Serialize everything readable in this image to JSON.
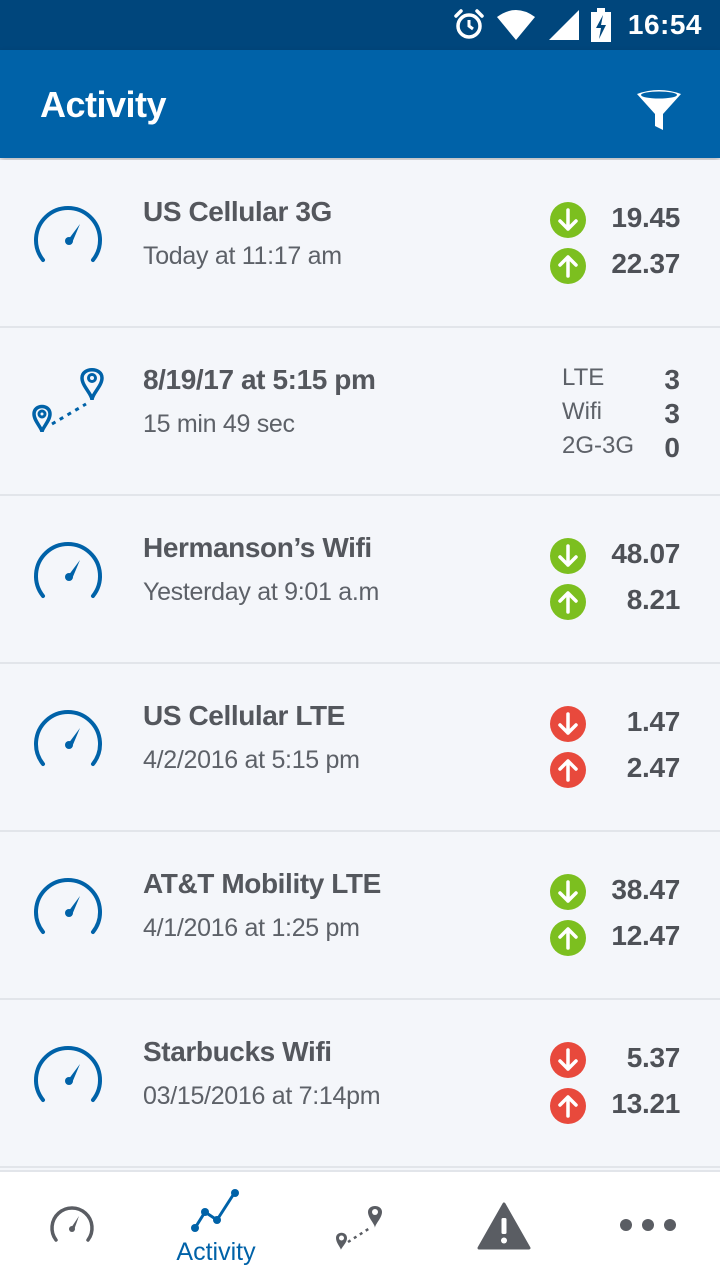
{
  "status_bar": {
    "time": "16:54",
    "icons": [
      "alarm-icon",
      "wifi-icon",
      "cell-signal-icon",
      "battery-icon"
    ]
  },
  "app_bar": {
    "title": "Activity",
    "filter_icon": "filter-icon"
  },
  "colors": {
    "primary": "#0062a8",
    "status_bar": "#00467c",
    "good": "#7cbf1f",
    "bad": "#e8493c",
    "background": "#f4f6fa"
  },
  "activity": [
    {
      "type": "speed_test",
      "title": "US Cellular 3G",
      "subtitle": "Today at 11:17 am",
      "status": "good",
      "download": "19.45",
      "upload": "22.37"
    },
    {
      "type": "trip",
      "title": "8/19/17 at 5:15 pm",
      "subtitle": "15 min 49 sec",
      "counts": [
        {
          "label": "LTE",
          "value": "3"
        },
        {
          "label": "Wifi",
          "value": "3"
        },
        {
          "label": "2G-3G",
          "value": "0"
        }
      ]
    },
    {
      "type": "speed_test",
      "title": "Hermanson’s Wifi",
      "subtitle": "Yesterday at 9:01 a.m",
      "status": "good",
      "download": "48.07",
      "upload": "8.21"
    },
    {
      "type": "speed_test",
      "title": "US Cellular LTE",
      "subtitle": "4/2/2016 at 5:15 pm",
      "status": "bad",
      "download": "1.47",
      "upload": "2.47"
    },
    {
      "type": "speed_test",
      "title": "AT&T Mobility LTE",
      "subtitle": "4/1/2016 at 1:25 pm",
      "status": "good",
      "download": "38.47",
      "upload": "12.47"
    },
    {
      "type": "speed_test",
      "title": "Starbucks  Wifi",
      "subtitle": "03/15/2016 at 7:14pm",
      "status": "bad",
      "download": "5.37",
      "upload": "13.21"
    }
  ],
  "bottom_nav": [
    {
      "icon": "speedometer-icon",
      "label": "",
      "active": false
    },
    {
      "icon": "activity-chart-icon",
      "label": "Activity",
      "active": true
    },
    {
      "icon": "route-icon",
      "label": "",
      "active": false
    },
    {
      "icon": "warning-icon",
      "label": "",
      "active": false
    },
    {
      "icon": "more-icon",
      "label": "",
      "active": false
    }
  ]
}
